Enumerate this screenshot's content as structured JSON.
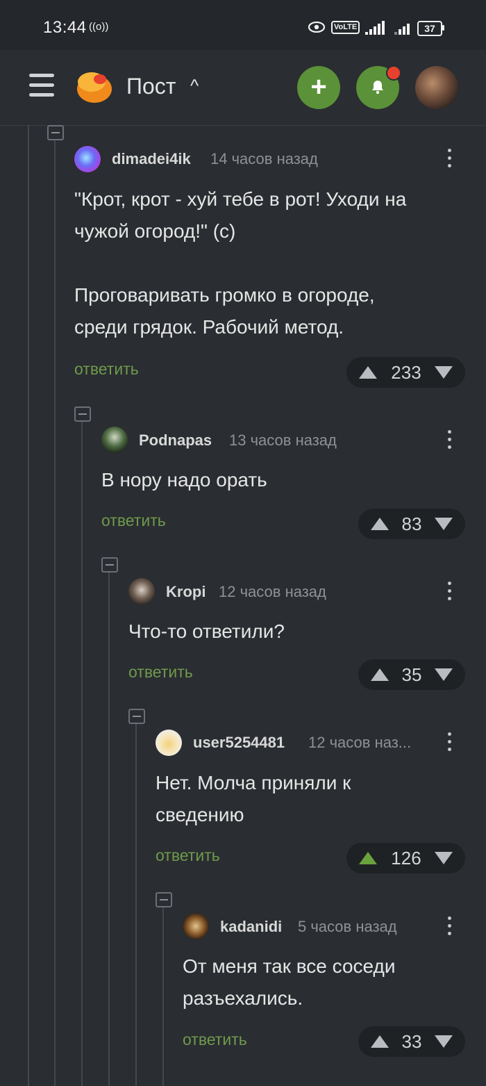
{
  "status": {
    "time": "13:44",
    "battery": "37",
    "volte": "VoLTE"
  },
  "header": {
    "title": "Пост"
  },
  "comments": [
    {
      "username": "dimadei4ik",
      "time": "14 часов назад",
      "text": "\"Крот, крот - хуй тебе в рот! Уходи на\nчужой огород!\" (с)\n\nПроговаривать громко в огороде,\nсреди грядок. Рабочий метод.",
      "reply": "ответить",
      "votes": "233",
      "upvoted": false
    },
    {
      "username": "Podnapas",
      "time": "13 часов назад",
      "text": "В нору надо орать",
      "reply": "ответить",
      "votes": "83",
      "upvoted": false
    },
    {
      "username": "Kropi",
      "time": "12 часов назад",
      "text": "Что-то ответили?",
      "reply": "ответить",
      "votes": "35",
      "upvoted": false
    },
    {
      "username": "user5254481",
      "time": "12 часов наз...",
      "text": "Нет. Молча приняли к\nсведению",
      "reply": "ответить",
      "votes": "126",
      "upvoted": true
    },
    {
      "username": "kadanidi",
      "time": "5 часов назад",
      "text": "От меня так все соседи\nразъехались.",
      "reply": "ответить",
      "votes": "33",
      "upvoted": false
    }
  ],
  "colors": {
    "accent": "#5b9138",
    "reply": "#6f9a4d",
    "upvote_active": "#6aa33d",
    "background": "#2a2d31"
  }
}
